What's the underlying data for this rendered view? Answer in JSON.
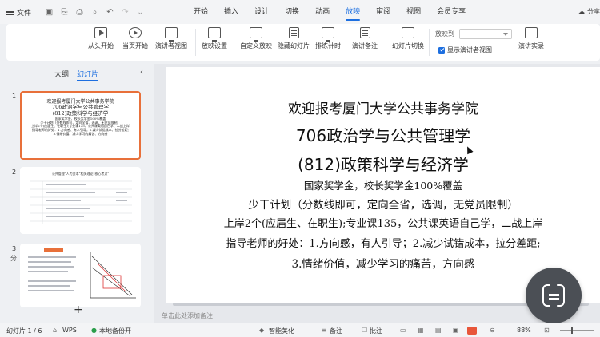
{
  "menubar": {
    "file": "文件",
    "tabs": [
      "开始",
      "插入",
      "设计",
      "切换",
      "动画",
      "放映",
      "审阅",
      "视图",
      "会员专享"
    ],
    "active_tab": "放映",
    "share": "分享"
  },
  "ribbon": {
    "from_start": "从头开始",
    "from_current": "当页开始",
    "presenter_view": "演讲者视图",
    "show_settings": "放映设置",
    "custom_show": "自定义放映",
    "hide_slide": "隐藏幻灯片",
    "rehearse": "排练计时",
    "speaker_notes": "演讲备注",
    "slide_transition": "幻灯片切换",
    "play_to_label": "放映到",
    "show_presenter_view": "显示演讲者视图",
    "speech_record": "演讲实录"
  },
  "left_panel": {
    "tab_outline": "大纲",
    "tab_slides": "幻灯片",
    "thumb1": {
      "lines": [
        "欢迎报考厦门大学公共事务学院",
        "706政治学与公共管理学",
        "(812)政策科学与经济学",
        "国家奖学金、校长奖学金100%覆盖",
        "少干计划（分数线即可、定向全省、选调、无党员限制）",
        "上岸2个(应届生、在职生);专业课135、公共课英语自己学、二战上岸",
        "指导老师的好处：1.方向感、有人引导；2.减少试错成本、拉分差距;",
        "3.情绪价值、减少学习的痛苦、方向感"
      ]
    },
    "thumb2_title": "公共管理\"人力资本\"相关理论\"核心考点\"",
    "anno": "分"
  },
  "slide": {
    "lines": [
      "欢迎报考厦门大学公共事务学院",
      "706政治学与公共管理学",
      "(812)政策科学与经济学",
      "国家奖学金，校长奖学金100%覆盖",
      "少干计划（分数线即可，定向全省，选调，无党员限制）",
      "上岸2个(应届生、在职生);专业课135，公共课英语自己学，二战上岸",
      "指导老师的好处：1.方向感，有人引导；2.减少试错成本，拉分差距;",
      "3.情绪价值，减少学习的痛苦，方向感"
    ],
    "notes_placeholder": "单击此处添加备注"
  },
  "status": {
    "slide_counter": "幻灯片 1 / 6",
    "app": "WPS",
    "backup": "本地备份开",
    "beautify": "智能美化",
    "notes": "备注",
    "comments": "批注",
    "zoom": "88%"
  }
}
